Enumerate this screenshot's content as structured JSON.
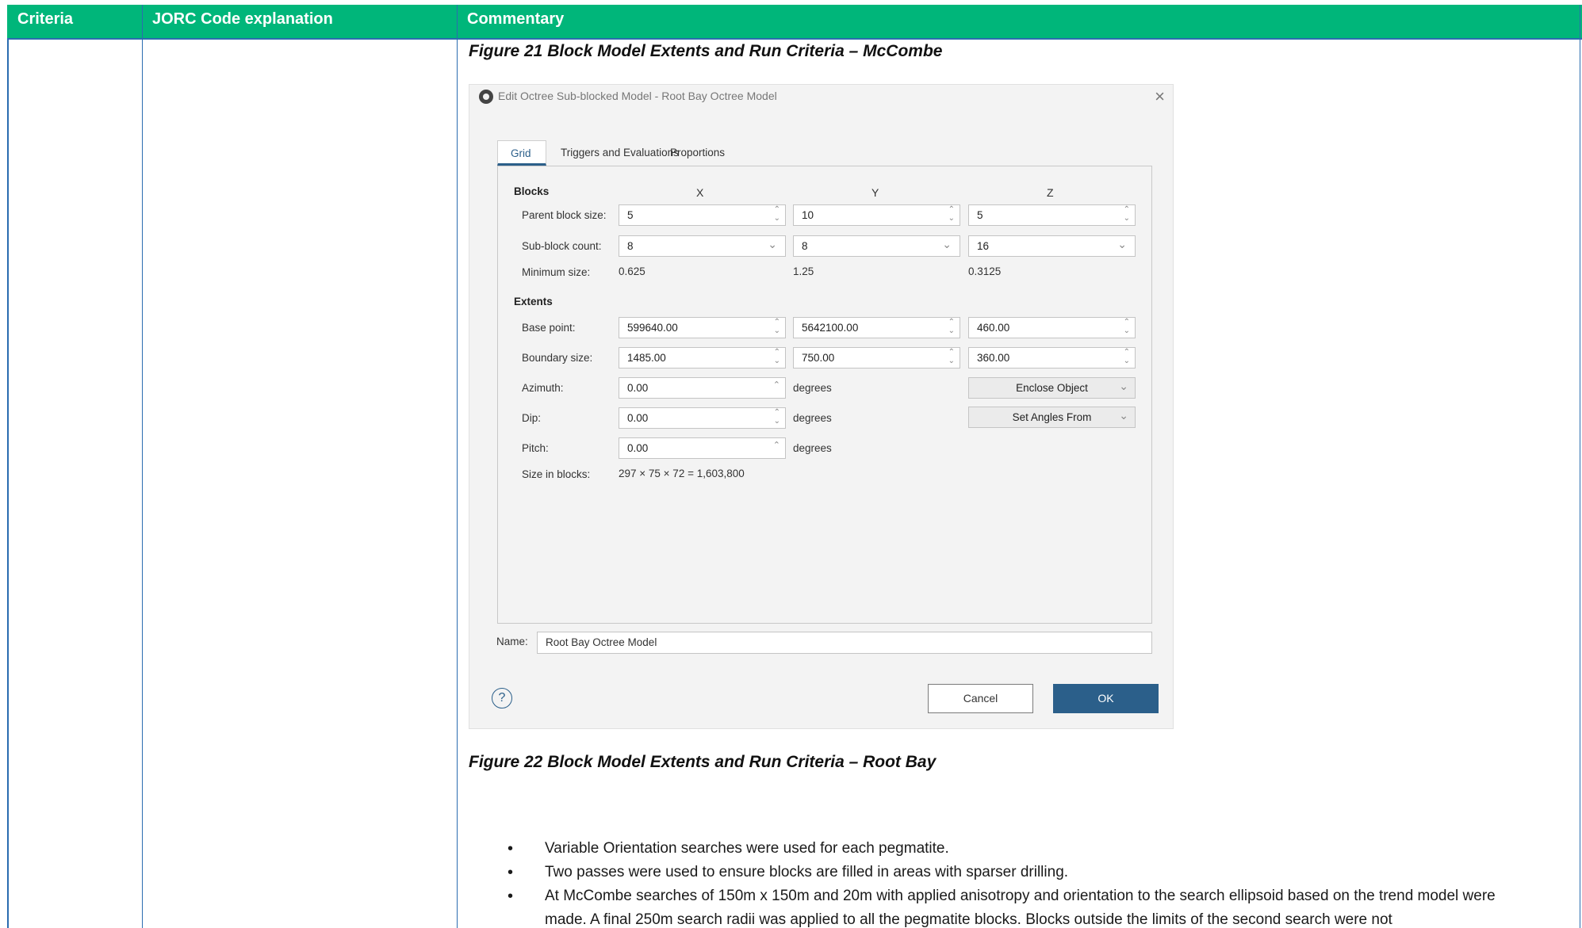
{
  "table": {
    "headers": [
      "Criteria",
      "JORC Code explanation",
      "Commentary"
    ]
  },
  "captions": {
    "fig21": "Figure 21 Block Model Extents and Run Criteria – McCombe",
    "fig22": "Figure 22 Block Model Extents and Run Criteria – Root Bay"
  },
  "dialog": {
    "title": "Edit Octree Sub-blocked Model - Root Bay Octree Model",
    "tabs": [
      "Grid",
      "Triggers and Evaluations",
      "Proportions"
    ],
    "blocks_label": "Blocks",
    "extents_label": "Extents",
    "col_x": "X",
    "col_y": "Y",
    "col_z": "Z",
    "parent_block_size": {
      "label": "Parent block size:",
      "x": "5",
      "y": "10",
      "z": "5"
    },
    "sub_block_count": {
      "label": "Sub-block count:",
      "x": "8",
      "y": "8",
      "z": "16"
    },
    "minimum_size": {
      "label": "Minimum size:",
      "x": "0.625",
      "y": "1.25",
      "z": "0.3125"
    },
    "base_point": {
      "label": "Base point:",
      "x": "599640.00",
      "y": "5642100.00",
      "z": "460.00"
    },
    "boundary_size": {
      "label": "Boundary size:",
      "x": "1485.00",
      "y": "750.00",
      "z": "360.00"
    },
    "azimuth": {
      "label": "Azimuth:",
      "value": "0.00",
      "unit": "degrees"
    },
    "dip": {
      "label": "Dip:",
      "value": "0.00",
      "unit": "degrees"
    },
    "pitch": {
      "label": "Pitch:",
      "value": "0.00",
      "unit": "degrees"
    },
    "enclose_object": "Enclose Object",
    "set_angles_from": "Set Angles From",
    "size_in_blocks": {
      "label": "Size in blocks:",
      "value": "297 × 75 × 72 = 1,603,800"
    },
    "name_label": "Name:",
    "name_value": "Root Bay Octree Model",
    "help": "?",
    "cancel": "Cancel",
    "ok": "OK"
  },
  "bullets": [
    "Variable Orientation searches were used for each pegmatite.",
    "Two passes were used to ensure blocks are filled in areas with sparser drilling.",
    "At McCombe searches of 150m x 150m and 20m with applied anisotropy and orientation to the search ellipsoid based on the trend model were made. A final 250m search radii was applied to all the pegmatite blocks. Blocks outside the limits of the second search were not"
  ]
}
